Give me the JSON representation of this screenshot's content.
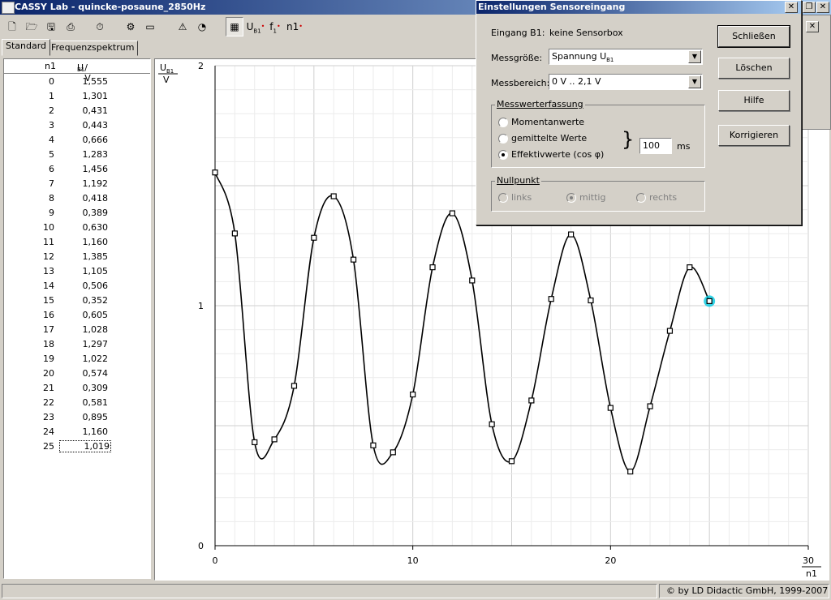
{
  "window": {
    "title": "CASSY Lab - quincke-posaune_2850Hz"
  },
  "toolbar": {
    "buttons": [
      {
        "name": "new-file-icon",
        "glyph": "🗋"
      },
      {
        "name": "open-file-icon",
        "glyph": "🗁"
      },
      {
        "name": "save-file-icon",
        "glyph": "🖫"
      },
      {
        "name": "print-icon",
        "glyph": "⎙"
      },
      {
        "name": "stopwatch-icon",
        "glyph": "⏱"
      },
      {
        "name": "settings-tool-icon",
        "glyph": "⚙"
      },
      {
        "name": "display-icon",
        "glyph": "▭"
      },
      {
        "name": "experiment-icon",
        "glyph": "⚠"
      },
      {
        "name": "help-icon",
        "glyph": "◔"
      }
    ],
    "u_label": "U",
    "u_sub": "B1",
    "f_label": "f",
    "f_sub": "1",
    "n_label": "n1"
  },
  "tabs": {
    "standard": "Standard",
    "spectrum": "Frequenzspektrum"
  },
  "table": {
    "col_n": "n1",
    "col_u": "U",
    "col_u_sub": "B1",
    "col_u_unit": " / V",
    "rows": [
      [
        "0",
        "1,555"
      ],
      [
        "1",
        "1,301"
      ],
      [
        "2",
        "0,431"
      ],
      [
        "3",
        "0,443"
      ],
      [
        "4",
        "0,666"
      ],
      [
        "5",
        "1,283"
      ],
      [
        "6",
        "1,456"
      ],
      [
        "7",
        "1,192"
      ],
      [
        "8",
        "0,418"
      ],
      [
        "9",
        "0,389"
      ],
      [
        "10",
        "0,630"
      ],
      [
        "11",
        "1,160"
      ],
      [
        "12",
        "1,385"
      ],
      [
        "13",
        "1,105"
      ],
      [
        "14",
        "0,506"
      ],
      [
        "15",
        "0,352"
      ],
      [
        "16",
        "0,605"
      ],
      [
        "17",
        "1,028"
      ],
      [
        "18",
        "1,297"
      ],
      [
        "19",
        "1,022"
      ],
      [
        "20",
        "0,574"
      ],
      [
        "21",
        "0,309"
      ],
      [
        "22",
        "0,581"
      ],
      [
        "23",
        "0,895"
      ],
      [
        "24",
        "1,160"
      ],
      [
        "25",
        "1,019"
      ]
    ]
  },
  "chart_data": {
    "type": "line",
    "xlabel": "n1",
    "ylabel": "U",
    "ylabel_sub": "B1",
    "yunit": "V",
    "xlim": [
      0,
      30
    ],
    "ylim": [
      0,
      2
    ],
    "x_ticks": [
      "0",
      "10",
      "20",
      "30"
    ],
    "y_ticks": [
      "0",
      "1",
      "2"
    ],
    "grid": true,
    "x": [
      0,
      1,
      2,
      3,
      4,
      5,
      6,
      7,
      8,
      9,
      10,
      11,
      12,
      13,
      14,
      15,
      16,
      17,
      18,
      19,
      20,
      21,
      22,
      23,
      24,
      25
    ],
    "values": [
      1.555,
      1.301,
      0.431,
      0.443,
      0.666,
      1.283,
      1.456,
      1.192,
      0.418,
      0.389,
      0.63,
      1.16,
      1.385,
      1.105,
      0.506,
      0.352,
      0.605,
      1.028,
      1.297,
      1.022,
      0.574,
      0.309,
      0.581,
      0.895,
      1.16,
      1.019
    ],
    "highlight_point": 25,
    "line_color": "#000000",
    "highlight_color": "#00c8e0"
  },
  "status": {
    "copyright": "© by LD Didactic GmbH, 1999-2007"
  },
  "dialog": {
    "title": "Einstellungen Sensoreingang",
    "eingang_label": "Eingang B1:",
    "eingang_value": "keine Sensorbox",
    "messgroesse_label": "Messgröße:",
    "messgroesse_value": "Spannung U",
    "messgroesse_sub": "B1",
    "messbereich_label": "Messbereich:",
    "messbereich_value": "0 V .. 2,1 V",
    "erfassung_title": "Messwerterfassung",
    "radio_moment": "Momentanwerte",
    "radio_gemittelt": "gemittelte Werte",
    "radio_effektiv": "Effektivwerte (cos φ)",
    "brace": "}",
    "interval_value": "100",
    "interval_unit": "ms",
    "nullpunkt_title": "Nullpunkt",
    "radio_links": "links",
    "radio_mittig": "mittig",
    "radio_rechts": "rechts",
    "btn_close": "Schließen",
    "btn_delete": "Löschen",
    "btn_help": "Hilfe",
    "btn_correct": "Korrigieren"
  }
}
